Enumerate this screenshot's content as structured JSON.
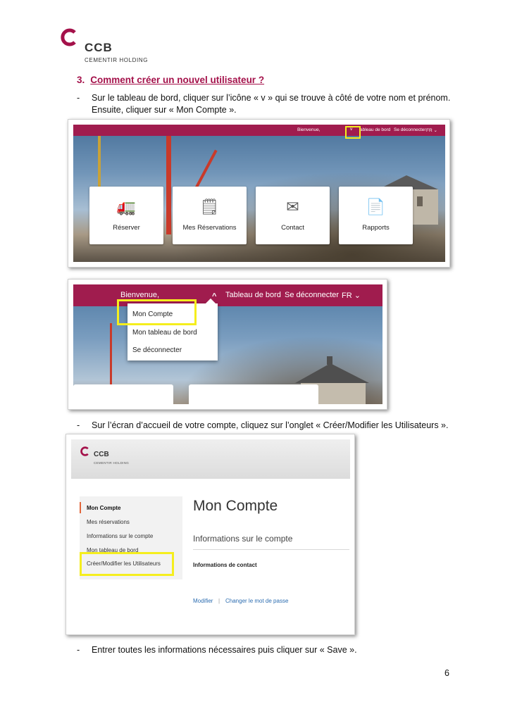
{
  "logo": {
    "name": "CCB",
    "subtitle": "CEMENTIR HOLDING",
    "color": "#a4114a"
  },
  "section": {
    "number": "3.",
    "title": "Comment créer un nouvel utilisateur ?"
  },
  "steps": [
    {
      "dash": "-",
      "lines": [
        "Sur le tableau de bord, cliquer sur l’icône « v » qui se trouve à côté de votre nom et prénom.",
        "Ensuite, cliquer sur « Mon Compte »."
      ]
    },
    {
      "dash": "-",
      "lines": [
        "Sur l’écran d’accueil de votre compte, cliquez sur l’onglet « Créer/Modifier les Utilisateurs »."
      ]
    },
    {
      "dash": "-",
      "lines": [
        "Entrer toutes les informations nécessaires puis cliquer sur « Save »."
      ]
    }
  ],
  "screenshot1": {
    "nav": {
      "welcome": "Bienvenue,",
      "chevron": "v",
      "dashboard": "ableau de bord",
      "logout": "Se déconnecter",
      "lang": "FR ⌄"
    },
    "tiles": [
      {
        "label": "Réserver",
        "icon": "mixer-truck-icon"
      },
      {
        "label": "Mes Réservations",
        "icon": "document-check-icon"
      },
      {
        "label": "Contact",
        "icon": "mail-phone-icon"
      },
      {
        "label": "Rapports",
        "icon": "report-pages-icon"
      }
    ]
  },
  "screenshot2": {
    "nav": {
      "welcome": "Bienvenue,",
      "chevron": "^",
      "dashboard": "Tableau de bord",
      "logout": "Se déconnecter",
      "lang": "FR ⌄"
    },
    "menu": [
      "Mon Compte",
      "Mon tableau de bord",
      "Se déconnecter"
    ]
  },
  "screenshot3": {
    "logo_name": "CCB",
    "logo_sub": "CEMENTIR HOLDING",
    "sidebar": [
      "Mon Compte",
      "Mes réservations",
      "Informations sur le compte",
      "Mon tableau de bord",
      "Créer/Modifier les Utilisateurs"
    ],
    "title": "Mon Compte",
    "subtitle": "Informations sur le compte",
    "contact": "Informations de contact",
    "links": {
      "edit": "Modifier",
      "separator": "|",
      "password": "Changer le mot de passe"
    }
  },
  "page_number": "6",
  "colors": {
    "brand": "#a01c4e",
    "highlight": "#f5ee1d",
    "link": "#2b6cb0",
    "active_marker": "#e2653a"
  }
}
